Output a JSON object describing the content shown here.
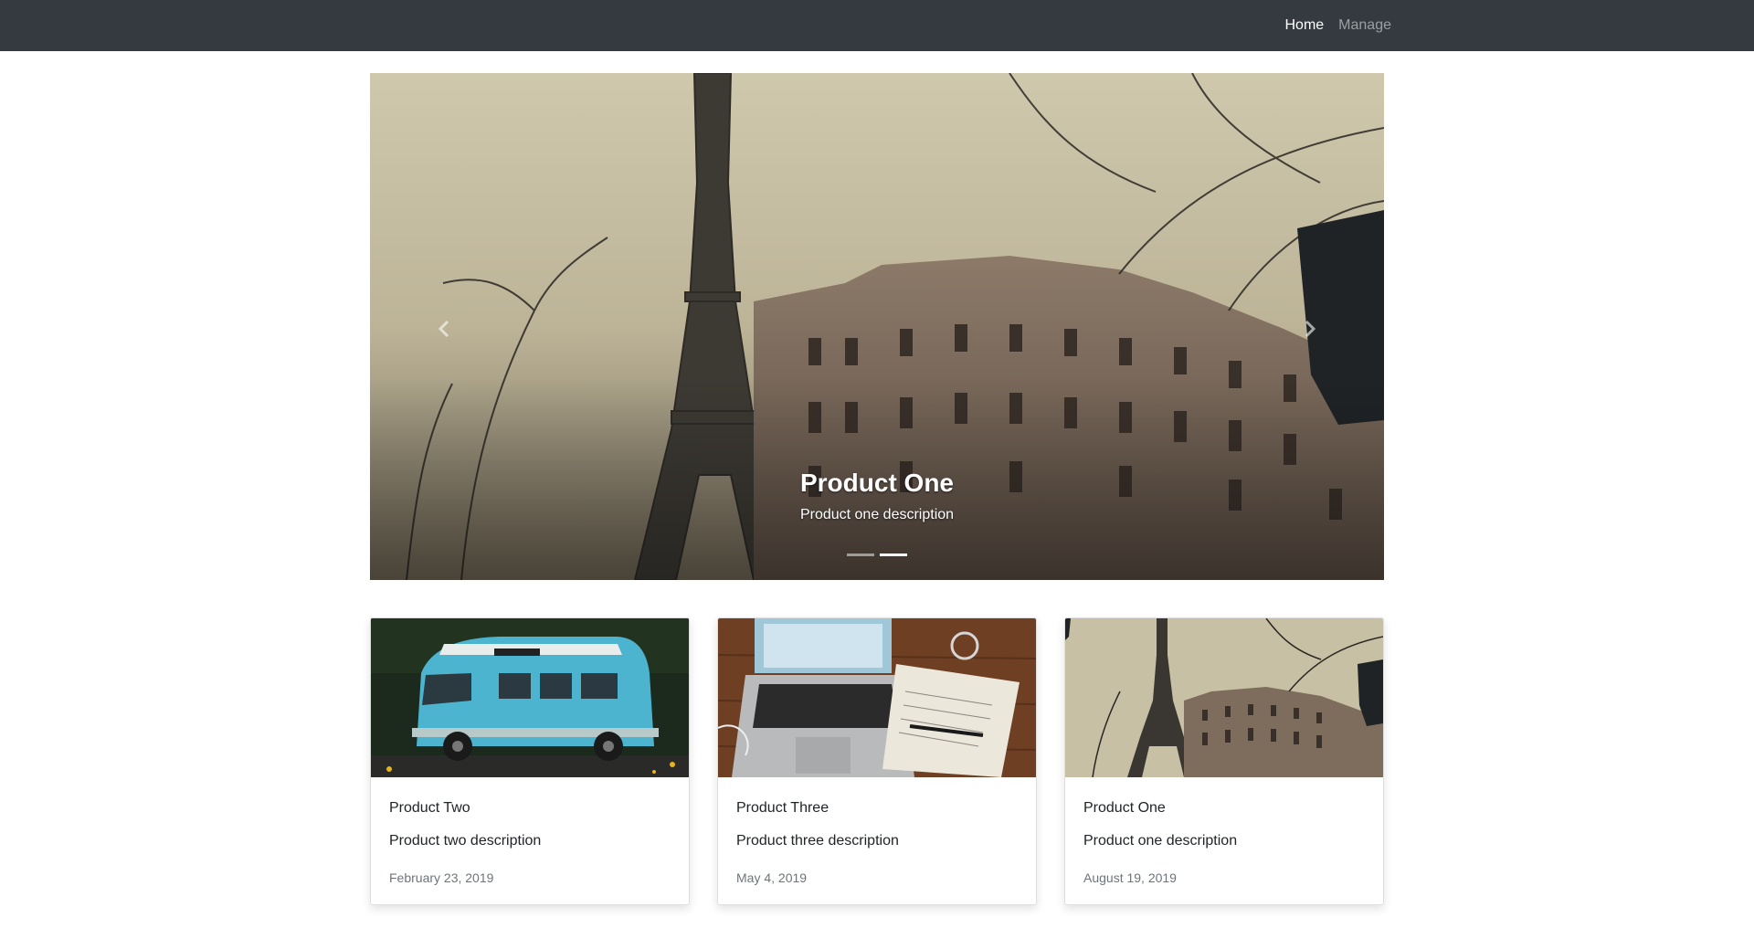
{
  "navbar": {
    "links": [
      {
        "label": "Home",
        "active": true
      },
      {
        "label": "Manage",
        "active": false
      }
    ]
  },
  "carousel": {
    "caption_title": "Product One",
    "caption_description": "Product one description",
    "image": "eiffel-tower-paris-street-photo",
    "slide_count": 2,
    "active_slide": 2,
    "prev_icon": "chevron-left-icon",
    "next_icon": "chevron-right-icon"
  },
  "cards": [
    {
      "title": "Product Two",
      "description": "Product two description",
      "date": "February 23, 2019",
      "image": "blue-vw-van-photo"
    },
    {
      "title": "Product Three",
      "description": "Product three description",
      "date": "May 4, 2019",
      "image": "laptop-notebook-desk-photo"
    },
    {
      "title": "Product One",
      "description": "Product one description",
      "date": "August 19, 2019",
      "image": "eiffel-tower-paris-street-photo"
    }
  ],
  "colors": {
    "navbar_bg": "#343a40",
    "nav_active": "#ffffff",
    "nav_inactive": "#9a9da0",
    "date_text": "#6c757d",
    "body_text": "#212529"
  }
}
